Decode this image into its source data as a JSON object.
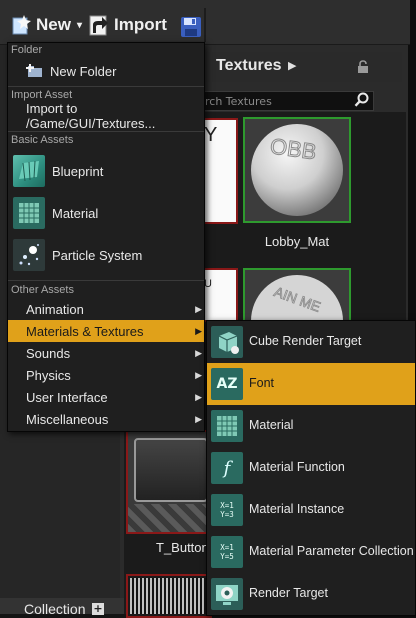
{
  "toolbar": {
    "new_label": "New",
    "import_label": "Import",
    "save_icon": "save-icon"
  },
  "path": {
    "folder": "Textures"
  },
  "search": {
    "placeholder": "rch Textures"
  },
  "assets": [
    {
      "label": ""
    },
    {
      "label": "Lobby_Mat"
    },
    {
      "label": ""
    },
    {
      "label": ""
    },
    {
      "label": "T_Button"
    },
    {
      "label": ""
    }
  ],
  "tile_fragments": {
    "t1": "Y",
    "t2": "U"
  },
  "collections": {
    "label": "Collection"
  },
  "new_menu": {
    "sections": {
      "folder": "Folder",
      "import": "Import Asset",
      "basic": "Basic Assets",
      "other": "Other Assets"
    },
    "new_folder": "New Folder",
    "import_to": "Import to /Game/GUI/Textures...",
    "basic_assets": [
      {
        "label": "Blueprint",
        "icon": "blueprint-icon"
      },
      {
        "label": "Material",
        "icon": "material-icon"
      },
      {
        "label": "Particle System",
        "icon": "particle-system-icon"
      }
    ],
    "other_assets": [
      {
        "label": "Animation"
      },
      {
        "label": "Materials & Textures",
        "highlighted": true
      },
      {
        "label": "Sounds"
      },
      {
        "label": "Physics"
      },
      {
        "label": "User Interface"
      },
      {
        "label": "Miscellaneous"
      }
    ]
  },
  "submenu": {
    "items": [
      {
        "label": "Cube Render Target",
        "icon": "cube-render-target-icon"
      },
      {
        "label": "Font",
        "icon": "font-icon",
        "highlighted": true
      },
      {
        "label": "Material",
        "icon": "material-icon"
      },
      {
        "label": "Material Function",
        "icon": "material-function-icon"
      },
      {
        "label": "Material Instance",
        "icon": "material-instance-icon"
      },
      {
        "label": "Material Parameter Collection",
        "icon": "material-parameter-collection-icon"
      },
      {
        "label": "Render Target",
        "icon": "render-target-icon"
      }
    ],
    "icon_text": {
      "font": "AZ",
      "function": "f",
      "instance": "X=1\nY=3",
      "param": "X=1\nY=5"
    }
  },
  "colors": {
    "highlight": "#e0a11a",
    "thumb_red_border": "#8a1818",
    "thumb_green_border": "#2e9a2e",
    "menu_bg": "#1f1f1f"
  }
}
